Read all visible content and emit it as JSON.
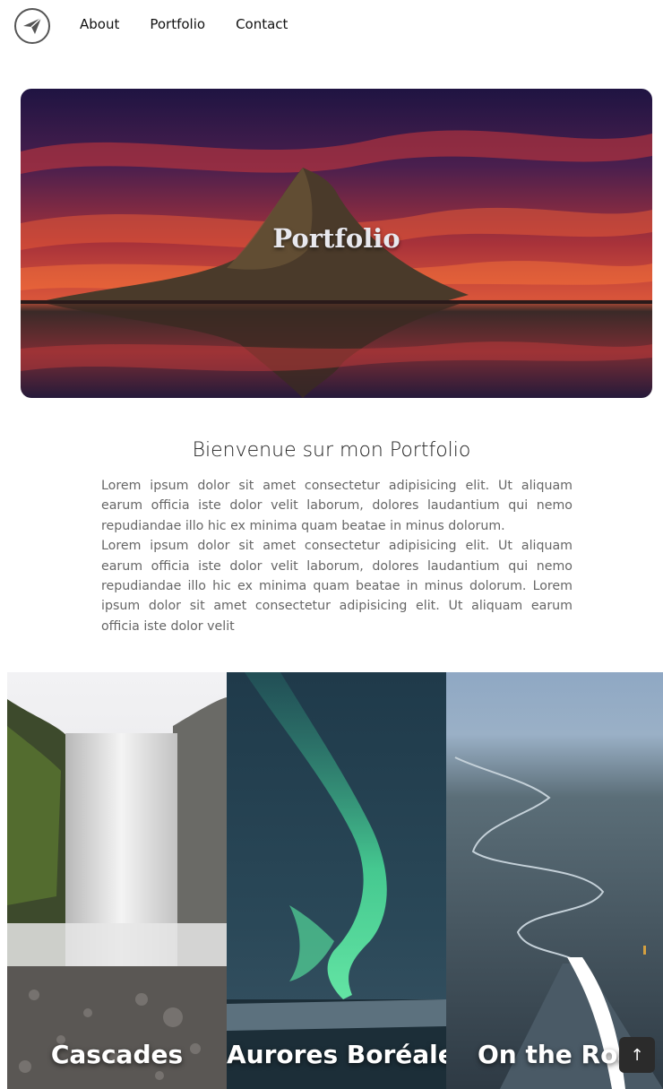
{
  "nav": {
    "logo_icon": "paper-plane-icon",
    "links": [
      "About",
      "Portfolio",
      "Contact"
    ]
  },
  "hero": {
    "title": "Portfolio"
  },
  "intro": {
    "title": "Bienvenue sur mon Portfolio",
    "paragraphs": [
      "Lorem ipsum dolor sit amet consectetur adipisicing elit. Ut aliquam earum officia iste dolor velit laborum, dolores laudantium qui nemo repudiandae illo hic ex minima quam beatae in minus dolorum.",
      "Lorem ipsum dolor sit amet consectetur adipisicing elit. Ut aliquam earum officia iste dolor velit laborum, dolores laudantium qui nemo repudiandae illo hic ex minima quam beatae in minus dolorum. Lorem ipsum dolor sit amet consectetur adipisicing elit. Ut aliquam earum officia iste dolor velit"
    ]
  },
  "gallery": {
    "cards": [
      {
        "label": "Cascades"
      },
      {
        "label": "Aurores Boréales"
      },
      {
        "label": "On the Road"
      }
    ]
  },
  "scroll_top": {
    "icon": "arrow-up-icon",
    "label": "↑"
  }
}
